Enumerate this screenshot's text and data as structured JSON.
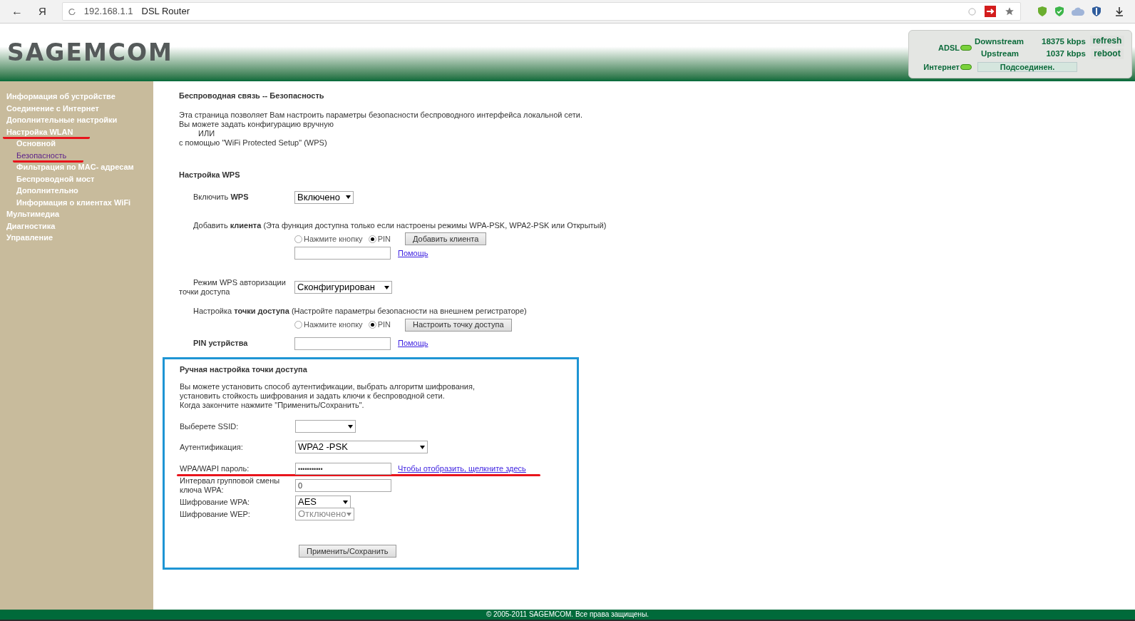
{
  "browser": {
    "back": "←",
    "home": "Я",
    "url": "192.168.1.1",
    "title": "DSL Router"
  },
  "header": {
    "logo": "SAGEMCOM",
    "adsl": {
      "label": "ADSL",
      "on": true
    },
    "internet": {
      "label": "Интернет",
      "on": true
    },
    "downstream": {
      "label": "Downstream",
      "value": "18375 kbps"
    },
    "upstream": {
      "label": "Upstream",
      "value": "1037 kbps"
    },
    "connection": "Подсоединен.",
    "buttons": [
      "refresh",
      "reboot"
    ]
  },
  "sidebar": {
    "items": [
      {
        "label": "Информация об устройстве",
        "selected": false,
        "underlined": false
      },
      {
        "label": "Соединение с Интернет",
        "selected": false,
        "underlined": false
      },
      {
        "label": "Дополнительные настройки",
        "selected": false,
        "underlined": false
      },
      {
        "label": "Настройка WLAN",
        "selected": false,
        "underlined": true,
        "children": [
          {
            "label": "Основной",
            "selected": false,
            "underlined": false
          },
          {
            "label": "Безопасность",
            "selected": true,
            "underlined": true
          },
          {
            "label": "Фильтрация по MAC- адресам",
            "selected": false,
            "underlined": false
          },
          {
            "label": "Беспроводной мост",
            "selected": false,
            "underlined": false
          },
          {
            "label": "Дополнительно",
            "selected": false,
            "underlined": false
          },
          {
            "label": "Информация о клиентах WiFi",
            "selected": false,
            "underlined": false
          }
        ]
      },
      {
        "label": "Мультимедиа",
        "selected": false,
        "underlined": false
      },
      {
        "label": "Диагностика",
        "selected": false,
        "underlined": false
      },
      {
        "label": "Управление",
        "selected": false,
        "underlined": false
      }
    ]
  },
  "page": {
    "title": "Беспроводная связь -- Безопасность",
    "intro": [
      "Эта страница позволяет Вам настроить параметры безопасности беспроводного интерфейса локальной сети.",
      "Вы можете задать конфигурацию вручную",
      "ИЛИ",
      "с помощью \"WiFi Protected Setup\" (WPS)"
    ],
    "wps": {
      "heading": "Настройка WPS",
      "enable": {
        "label": "Включить **WPS**",
        "value": "Включено"
      },
      "add_client": {
        "label": "Добавить **клиента** (Эта функция доступна только если настроены режимы WPA-PSK, WPA2-PSK или Открытый)",
        "options": [
          {
            "label": "Нажмите кнопку",
            "selected": false
          },
          {
            "label": "PIN",
            "selected": true
          }
        ],
        "button": "Добавить клиента",
        "help": "Помощь"
      },
      "ap_mode": {
        "label": "Режим WPS авторизации точки доступа",
        "value": "Сконфигурирован"
      },
      "ap_setup": {
        "label": "Настройка **точки доступа** (Настройте параметры безопасности на внешнем регистраторе)",
        "options": [
          {
            "label": "Нажмите кнопку",
            "selected": false
          },
          {
            "label": "PIN",
            "selected": true
          }
        ],
        "button": "Настроить точку доступа"
      },
      "device_pin": {
        "label": "PIN устрйства",
        "help": "Помощь"
      }
    },
    "manual": {
      "highlighted": true,
      "heading": "Ручная настройка точки доступа",
      "description": [
        "Вы можете установить способ аутентификации, выбрать алгоритм шифрования,",
        "установить стойкость шифрования и задать ключи к беспроводной сети.",
        "Когда закончите нажмите \"Применить/Сохранить\"."
      ],
      "ssid": {
        "label": "Выберете SSID:"
      },
      "auth": {
        "label": "Аутентификация:",
        "value": "WPA2 -PSK"
      },
      "password": {
        "label": "WPA/WAPI пароль:",
        "value": "•••••••••••",
        "link": "Чтобы отобразить, щелкните здесь",
        "underlined": true
      },
      "interval": {
        "label": "Интервал групповой смены ключа WPA:",
        "value": "0"
      },
      "wpa": {
        "label": "Шифрование WPA:",
        "value": "AES",
        "disabled": false
      },
      "wep": {
        "label": "Шифрование WEP:",
        "value": "Отключено",
        "disabled": true
      },
      "apply": "Применить/Сохранить"
    }
  },
  "footer": "© 2005-2011 SAGEMCOM. Все права защищены."
}
